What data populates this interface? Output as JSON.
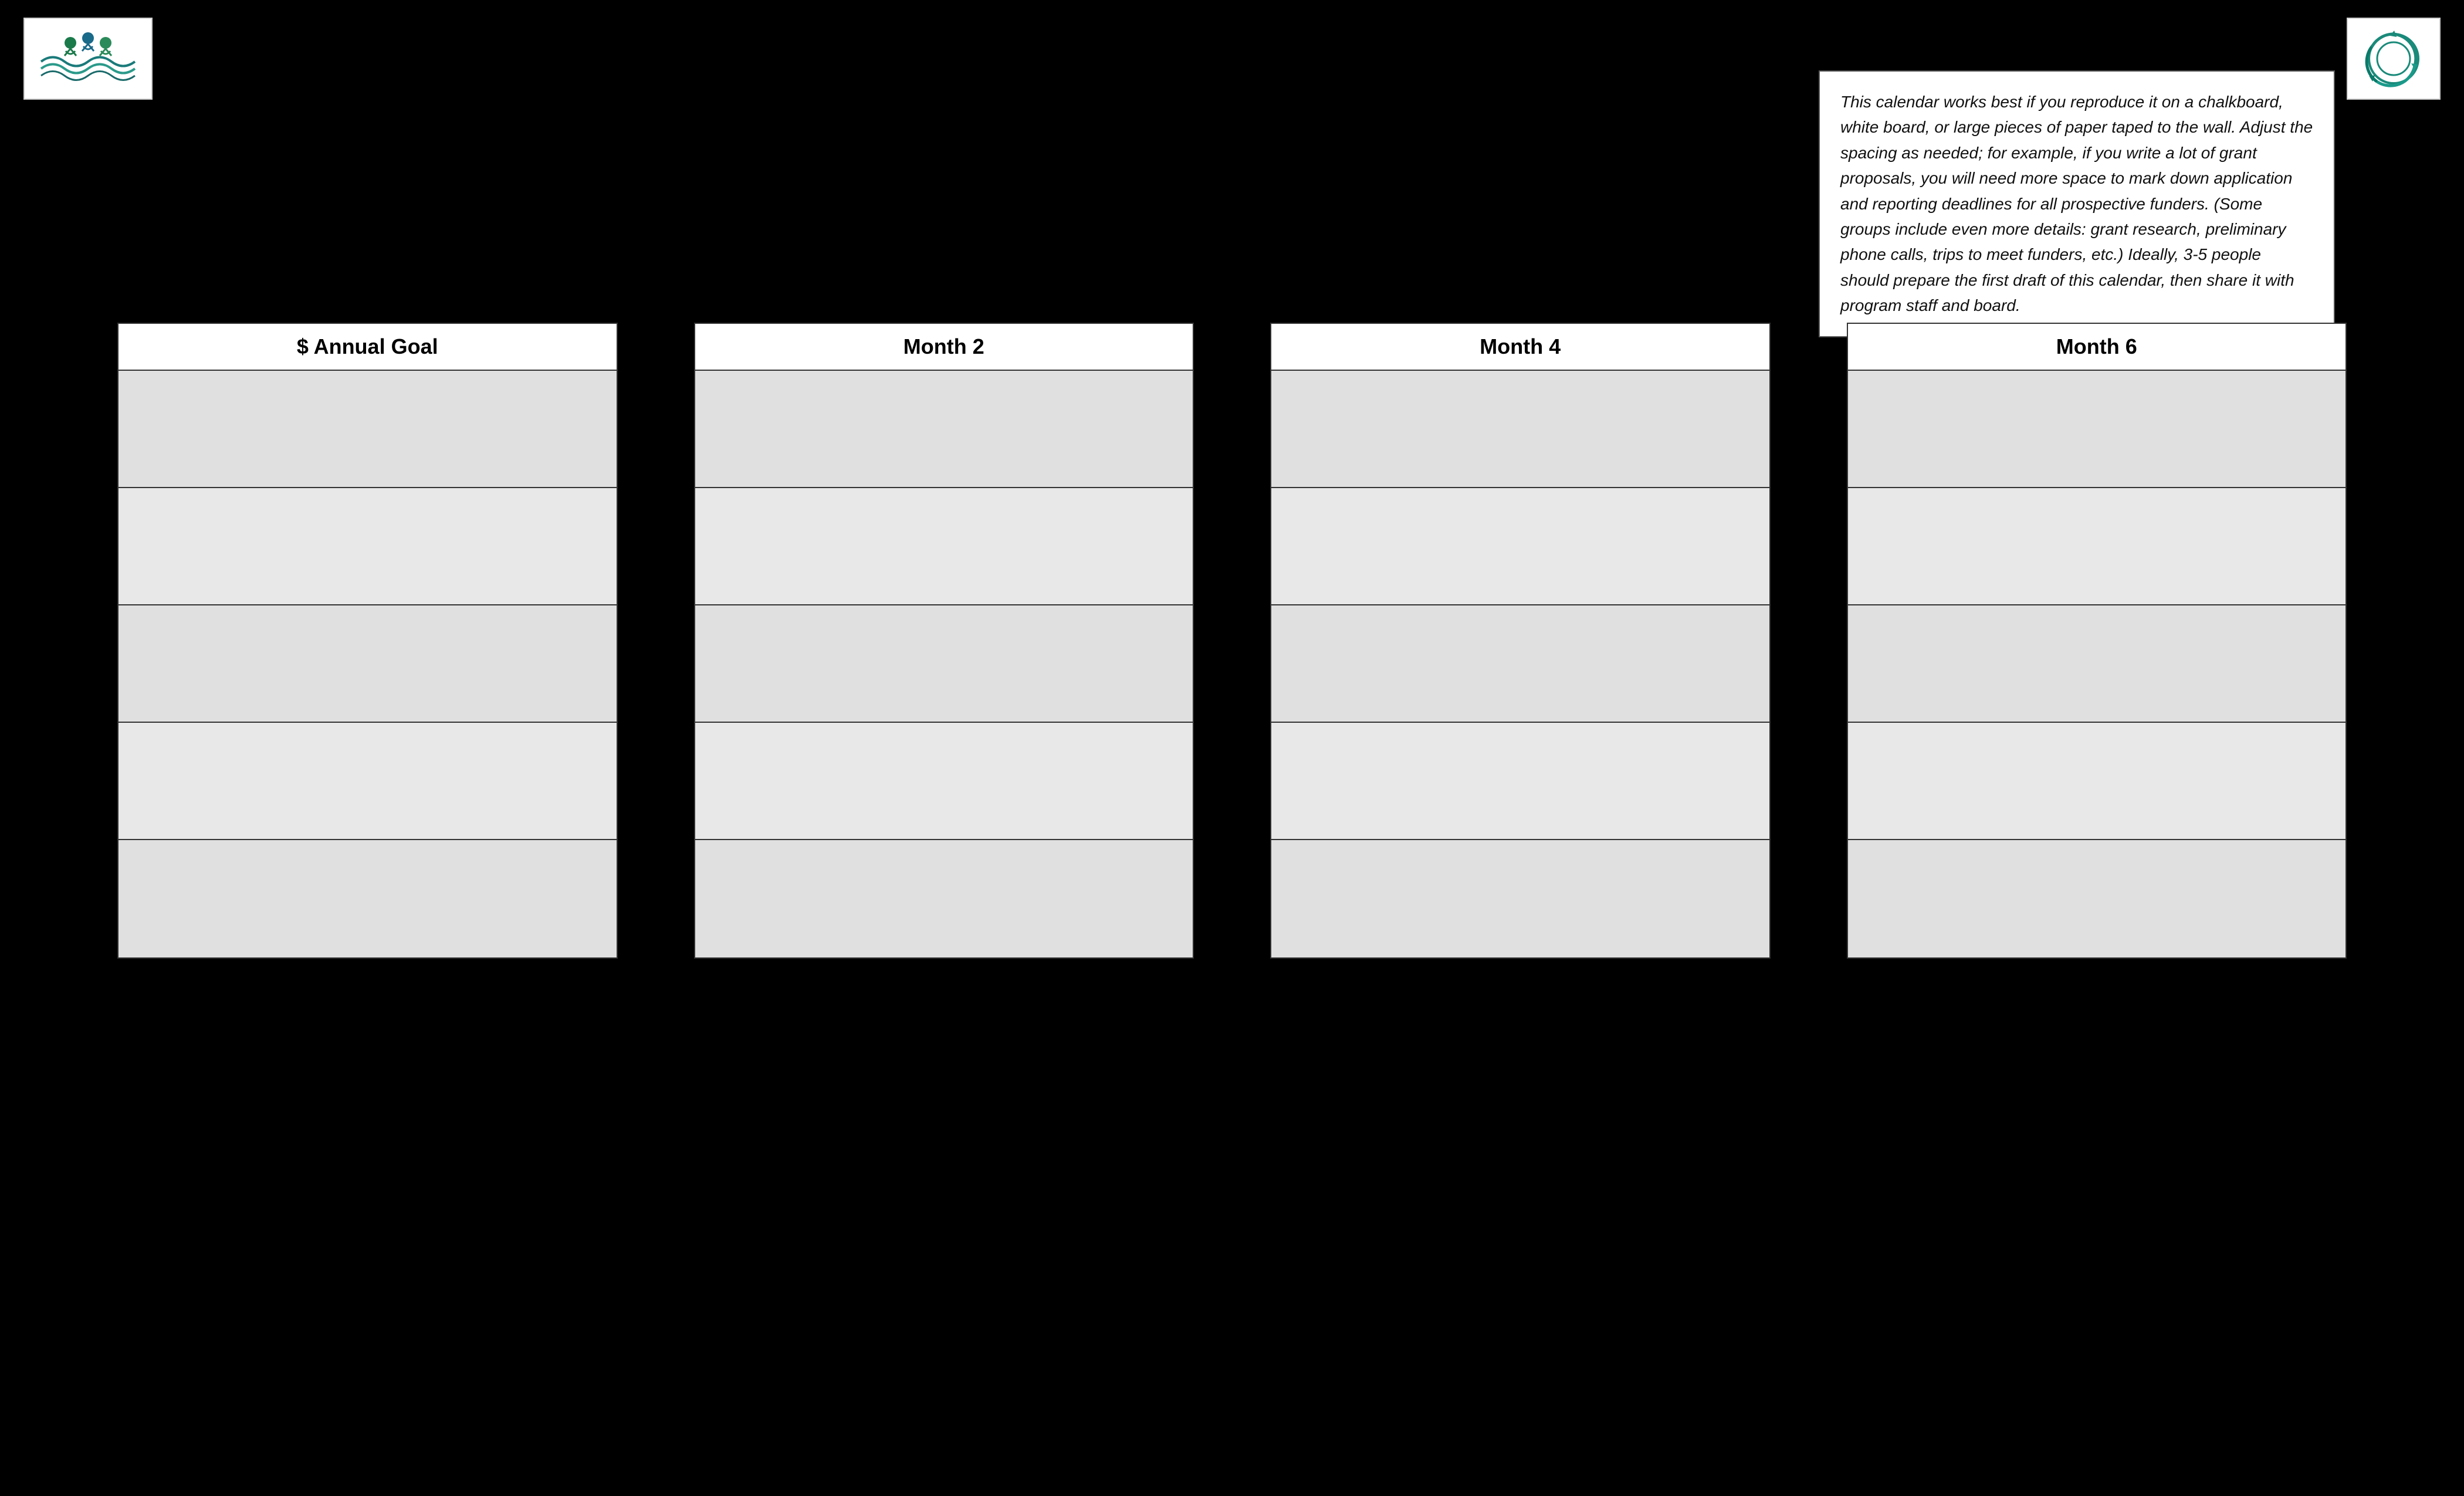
{
  "left_logo": {
    "alt": "Organization Logo Left"
  },
  "right_logo": {
    "alt": "Organization Logo Right"
  },
  "info_box": {
    "text": "This calendar works best if you reproduce it on a chalkboard, white board, or large pieces of paper taped to the wall.  Adjust the spacing as needed; for example, if you write a lot of grant proposals, you will need more space to mark down application and reporting deadlines for all prospective funders. (Some groups include even more details: grant research, preliminary phone calls, trips to meet funders, etc.)  Ideally, 3-5 people should prepare the first draft of this calendar, then share it with program staff and board."
  },
  "columns": [
    {
      "id": "col-annual",
      "header": "$ Annual Goal",
      "rows": 5
    },
    {
      "id": "col-month2",
      "header": "Month 2",
      "rows": 5
    },
    {
      "id": "col-month4",
      "header": "Month 4",
      "rows": 5
    },
    {
      "id": "col-month6",
      "header": "Month 6",
      "rows": 5
    }
  ]
}
